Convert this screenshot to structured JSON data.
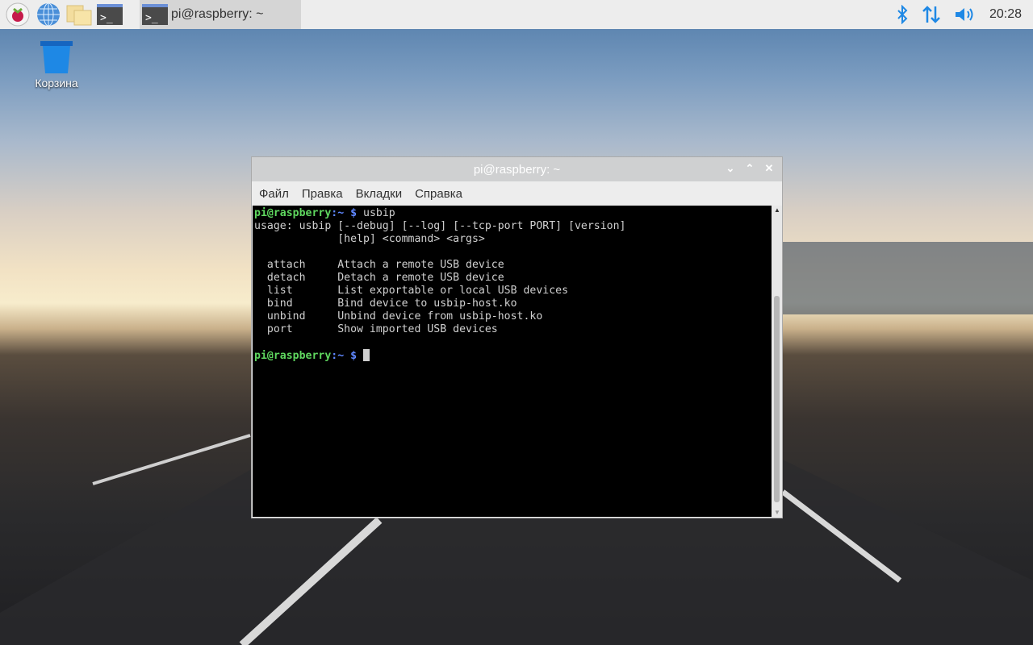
{
  "taskbar": {
    "launchers": [
      {
        "icon": "raspberry-menu-icon"
      },
      {
        "icon": "globe-browser-icon"
      },
      {
        "icon": "folder-icon"
      },
      {
        "icon": "terminal-icon"
      }
    ],
    "task_label": "pi@raspberry: ~",
    "clock": "20:28"
  },
  "desktop": {
    "trash_label": "Корзина"
  },
  "window": {
    "title": "pi@raspberry: ~",
    "menu": [
      "Файл",
      "Правка",
      "Вкладки",
      "Справка"
    ],
    "prompt_user": "pi@raspberry",
    "prompt_path": ":~",
    "prompt_sign": " $ ",
    "command": "usbip",
    "output": [
      "usage: usbip [--debug] [--log] [--tcp-port PORT] [version]",
      "             [help] <command> <args>",
      "",
      "  attach     Attach a remote USB device",
      "  detach     Detach a remote USB device",
      "  list       List exportable or local USB devices",
      "  bind       Bind device to usbip-host.ko",
      "  unbind     Unbind device from usbip-host.ko",
      "  port       Show imported USB devices",
      ""
    ]
  }
}
